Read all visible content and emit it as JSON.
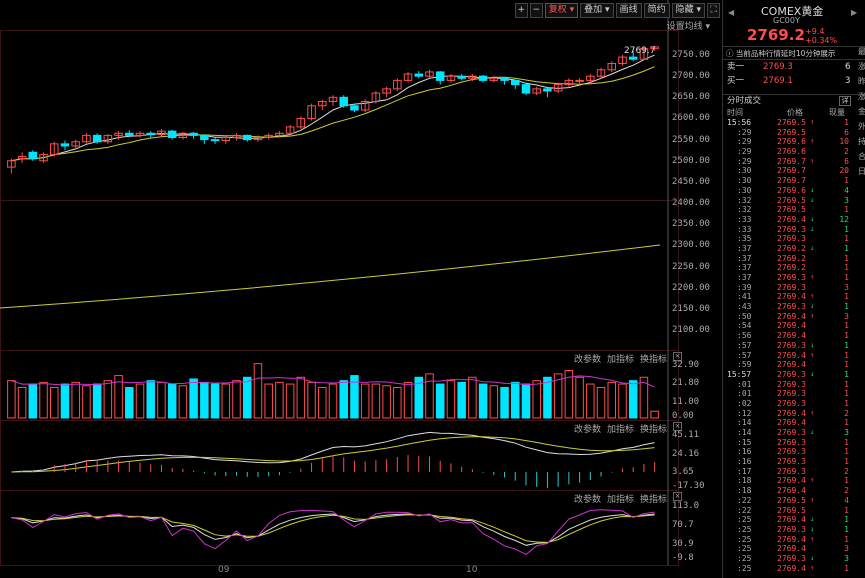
{
  "toolbar": {
    "plus": "+",
    "minus": "−",
    "fuquan": "复权",
    "overlay": "叠加",
    "draw": "画线",
    "simple": "简约",
    "hide": "隐藏",
    "fullscreen_icon": "fullscreen-icon"
  },
  "ma_setting": "设置均线",
  "last_price_label": "2769.7",
  "panel_controls": {
    "change_params": "改参数",
    "add_indicator": "加指标",
    "switch_indicator": "换指标",
    "close": "×"
  },
  "price_axis": [
    "2750.00",
    "2700.00",
    "2650.00",
    "2600.00",
    "2550.00",
    "2500.00",
    "2450.00",
    "2400.00",
    "2350.00",
    "2300.00",
    "2250.00",
    "2200.00",
    "2150.00",
    "2100.00"
  ],
  "volume_axis": [
    "32.90",
    "21.80",
    "11.00",
    "0.00"
  ],
  "macd_axis": [
    "45.11",
    "24.16",
    "3.65",
    "-17.30"
  ],
  "kdj_axis": [
    "113.0",
    "70.7",
    "30.9",
    "-9.8"
  ],
  "x_labels": [
    "09",
    "10"
  ],
  "sidebar": {
    "title": "COMEX黄金",
    "code": "GC00Y",
    "price": "2769.2",
    "change": "+9.4",
    "change_pct": "+0.34%",
    "delay_note": "当前品种行情延时10分钟展示",
    "ask_label": "卖一",
    "ask_price": "2769.3",
    "ask_vol": "6",
    "bid_label": "买一",
    "bid_price": "2769.1",
    "bid_vol": "3",
    "tape_title": "分时成交",
    "detail_btn": "详",
    "col_time": "时间",
    "col_price": "价格",
    "col_vol": "现量",
    "right_col": [
      "最",
      "涨",
      "昨",
      "涨",
      "金",
      "外",
      "持",
      "合",
      "日"
    ]
  },
  "tape": [
    {
      "t": "15:56",
      "p": "2769.5",
      "a": "up",
      "q": "1"
    },
    {
      "t": ":29",
      "p": "2769.5",
      "a": "",
      "q": "6"
    },
    {
      "t": ":29",
      "p": "2769.6",
      "a": "up",
      "q": "10"
    },
    {
      "t": ":29",
      "p": "2769.6",
      "a": "",
      "q": "2"
    },
    {
      "t": ":29",
      "p": "2769.7",
      "a": "up",
      "q": "6"
    },
    {
      "t": ":30",
      "p": "2769.7",
      "a": "",
      "q": "20"
    },
    {
      "t": ":30",
      "p": "2769.7",
      "a": "",
      "q": "1"
    },
    {
      "t": ":30",
      "p": "2769.6",
      "a": "dn",
      "q": "4"
    },
    {
      "t": ":32",
      "p": "2769.5",
      "a": "dn",
      "q": "3"
    },
    {
      "t": ":32",
      "p": "2769.5",
      "a": "",
      "q": "1"
    },
    {
      "t": ":33",
      "p": "2769.4",
      "a": "dn",
      "q": "12"
    },
    {
      "t": ":33",
      "p": "2769.3",
      "a": "dn",
      "q": "1"
    },
    {
      "t": ":35",
      "p": "2769.3",
      "a": "",
      "q": "1"
    },
    {
      "t": ":37",
      "p": "2769.2",
      "a": "dn",
      "q": "1"
    },
    {
      "t": ":37",
      "p": "2769.2",
      "a": "",
      "q": "1"
    },
    {
      "t": ":37",
      "p": "2769.2",
      "a": "",
      "q": "1"
    },
    {
      "t": ":37",
      "p": "2769.3",
      "a": "up",
      "q": "1"
    },
    {
      "t": ":39",
      "p": "2769.3",
      "a": "",
      "q": "3"
    },
    {
      "t": ":41",
      "p": "2769.4",
      "a": "up",
      "q": "1"
    },
    {
      "t": ":43",
      "p": "2769.3",
      "a": "dn",
      "q": "1"
    },
    {
      "t": ":50",
      "p": "2769.4",
      "a": "up",
      "q": "3"
    },
    {
      "t": ":54",
      "p": "2769.4",
      "a": "",
      "q": "1"
    },
    {
      "t": ":56",
      "p": "2769.4",
      "a": "",
      "q": "1"
    },
    {
      "t": ":57",
      "p": "2769.3",
      "a": "dn",
      "q": "1"
    },
    {
      "t": ":57",
      "p": "2769.4",
      "a": "up",
      "q": "1"
    },
    {
      "t": ":59",
      "p": "2769.4",
      "a": "",
      "q": "1"
    },
    {
      "t": "15:57",
      "p": "2769.3",
      "a": "dn",
      "q": "1"
    },
    {
      "t": ":01",
      "p": "2769.3",
      "a": "",
      "q": "1"
    },
    {
      "t": ":01",
      "p": "2769.3",
      "a": "",
      "q": "1"
    },
    {
      "t": ":02",
      "p": "2769.3",
      "a": "",
      "q": "1"
    },
    {
      "t": ":12",
      "p": "2769.4",
      "a": "up",
      "q": "2"
    },
    {
      "t": ":14",
      "p": "2769.4",
      "a": "",
      "q": "1"
    },
    {
      "t": ":14",
      "p": "2769.3",
      "a": "dn",
      "q": "3"
    },
    {
      "t": ":15",
      "p": "2769.3",
      "a": "",
      "q": "1"
    },
    {
      "t": ":16",
      "p": "2769.3",
      "a": "",
      "q": "1"
    },
    {
      "t": ":16",
      "p": "2769.3",
      "a": "",
      "q": "1"
    },
    {
      "t": ":17",
      "p": "2769.3",
      "a": "",
      "q": "2"
    },
    {
      "t": ":18",
      "p": "2769.4",
      "a": "up",
      "q": "1"
    },
    {
      "t": ":18",
      "p": "2769.4",
      "a": "",
      "q": "2"
    },
    {
      "t": ":22",
      "p": "2769.5",
      "a": "up",
      "q": "4"
    },
    {
      "t": ":22",
      "p": "2769.5",
      "a": "",
      "q": "1"
    },
    {
      "t": ":25",
      "p": "2769.4",
      "a": "dn",
      "q": "1"
    },
    {
      "t": ":25",
      "p": "2769.3",
      "a": "dn",
      "q": "1"
    },
    {
      "t": ":25",
      "p": "2769.4",
      "a": "up",
      "q": "1"
    },
    {
      "t": ":25",
      "p": "2769.4",
      "a": "",
      "q": "3"
    },
    {
      "t": ":25",
      "p": "2769.3",
      "a": "dn",
      "q": "3"
    },
    {
      "t": ":25",
      "p": "2769.4",
      "a": "up",
      "q": "1"
    }
  ],
  "chart_data": {
    "type": "candlestick",
    "colors": {
      "up": "#ff4d4d",
      "down": "#00e5ff",
      "ma1": "#dddddd",
      "ma2": "#cccc33",
      "ma3": "#cc33cc"
    },
    "price_ylim": [
      2400,
      2780
    ],
    "candles": [
      [
        2485,
        2500,
        2470,
        2505
      ],
      [
        2505,
        2510,
        2495,
        2520
      ],
      [
        2520,
        2505,
        2500,
        2525
      ],
      [
        2500,
        2515,
        2495,
        2520
      ],
      [
        2515,
        2540,
        2510,
        2545
      ],
      [
        2540,
        2535,
        2525,
        2548
      ],
      [
        2535,
        2545,
        2530,
        2550
      ],
      [
        2545,
        2560,
        2540,
        2565
      ],
      [
        2560,
        2545,
        2540,
        2565
      ],
      [
        2545,
        2560,
        2540,
        2563
      ],
      [
        2560,
        2565,
        2550,
        2570
      ],
      [
        2565,
        2560,
        2555,
        2572
      ],
      [
        2560,
        2565,
        2555,
        2570
      ],
      [
        2565,
        2562,
        2555,
        2570
      ],
      [
        2562,
        2570,
        2558,
        2575
      ],
      [
        2570,
        2555,
        2550,
        2573
      ],
      [
        2555,
        2565,
        2550,
        2568
      ],
      [
        2565,
        2560,
        2552,
        2568
      ],
      [
        2560,
        2550,
        2540,
        2562
      ],
      [
        2550,
        2548,
        2540,
        2555
      ],
      [
        2548,
        2555,
        2540,
        2560
      ],
      [
        2555,
        2560,
        2548,
        2565
      ],
      [
        2560,
        2550,
        2545,
        2562
      ],
      [
        2550,
        2555,
        2545,
        2560
      ],
      [
        2555,
        2560,
        2550,
        2565
      ],
      [
        2560,
        2565,
        2555,
        2570
      ],
      [
        2565,
        2580,
        2560,
        2585
      ],
      [
        2580,
        2600,
        2575,
        2605
      ],
      [
        2600,
        2630,
        2595,
        2635
      ],
      [
        2630,
        2640,
        2620,
        2645
      ],
      [
        2640,
        2650,
        2630,
        2655
      ],
      [
        2650,
        2630,
        2625,
        2655
      ],
      [
        2630,
        2620,
        2615,
        2635
      ],
      [
        2620,
        2640,
        2615,
        2645
      ],
      [
        2640,
        2660,
        2635,
        2665
      ],
      [
        2660,
        2670,
        2650,
        2675
      ],
      [
        2670,
        2690,
        2665,
        2695
      ],
      [
        2690,
        2705,
        2685,
        2710
      ],
      [
        2705,
        2700,
        2695,
        2712
      ],
      [
        2700,
        2710,
        2695,
        2715
      ],
      [
        2710,
        2690,
        2680,
        2712
      ],
      [
        2690,
        2700,
        2685,
        2705
      ],
      [
        2700,
        2695,
        2690,
        2705
      ],
      [
        2695,
        2700,
        2688,
        2705
      ],
      [
        2700,
        2690,
        2685,
        2703
      ],
      [
        2690,
        2695,
        2685,
        2700
      ],
      [
        2695,
        2690,
        2680,
        2698
      ],
      [
        2690,
        2680,
        2670,
        2692
      ],
      [
        2680,
        2660,
        2655,
        2685
      ],
      [
        2660,
        2670,
        2655,
        2675
      ],
      [
        2670,
        2665,
        2650,
        2675
      ],
      [
        2665,
        2680,
        2660,
        2685
      ],
      [
        2680,
        2690,
        2675,
        2695
      ],
      [
        2690,
        2690,
        2680,
        2695
      ],
      [
        2690,
        2700,
        2685,
        2705
      ],
      [
        2700,
        2715,
        2695,
        2720
      ],
      [
        2715,
        2730,
        2710,
        2735
      ],
      [
        2730,
        2745,
        2725,
        2750
      ],
      [
        2745,
        2740,
        2735,
        2760
      ],
      [
        2740,
        2765,
        2738,
        2770
      ],
      [
        2765,
        2769,
        2760,
        2772
      ]
    ],
    "volume": [
      22,
      18,
      20,
      21,
      18,
      20,
      21,
      19,
      20,
      22,
      25,
      18,
      20,
      22,
      21,
      20,
      19,
      23,
      21,
      20,
      20,
      22,
      24,
      32,
      20,
      21,
      20,
      24,
      21,
      18,
      20,
      22,
      25,
      20,
      20,
      19,
      18,
      21,
      24,
      26,
      20,
      22,
      21,
      24,
      20,
      19,
      18,
      21,
      20,
      22,
      24,
      26,
      28,
      24,
      20,
      18,
      21,
      20,
      22,
      24,
      4
    ],
    "volume_ylim": [
      0,
      33
    ],
    "macd_ylim": [
      -17.3,
      45.11
    ],
    "kdj_ylim": [
      -9.8,
      113
    ]
  }
}
